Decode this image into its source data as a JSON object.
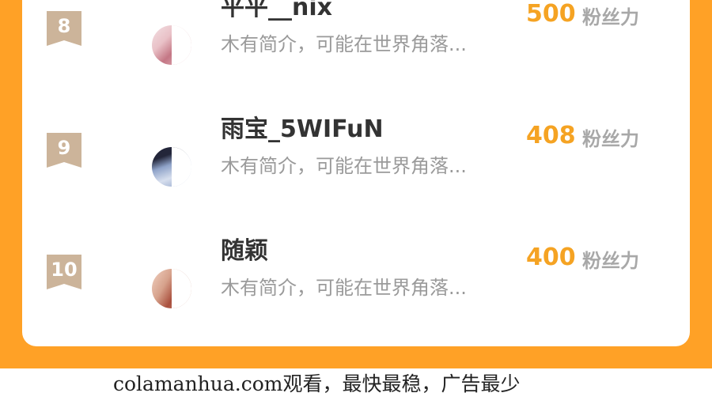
{
  "ranking": [
    {
      "rank": "8",
      "name": "平平__nix",
      "intro": "木有简介，可能在世界角落...",
      "score": "500",
      "unit": "粉丝力",
      "avatar_colors": [
        "#e9c1c7",
        "#c47785",
        "#f3e0e3"
      ]
    },
    {
      "rank": "9",
      "name": "雨宝_5WIFuN",
      "intro": "木有简介，可能在世界角落...",
      "score": "408",
      "unit": "粉丝力",
      "avatar_colors": [
        "#23263a",
        "#8fa3c9",
        "#d7dfee"
      ]
    },
    {
      "rank": "10",
      "name": "随颖",
      "intro": "木有简介，可能在世界角落...",
      "score": "400",
      "unit": "粉丝力",
      "avatar_colors": [
        "#a94f3d",
        "#d6a18b",
        "#f1d2c2"
      ]
    }
  ],
  "footer": {
    "text": "colamanhua.com观看，最快最稳，广告最少"
  },
  "colors": {
    "background_orange": "#ffa126",
    "score_orange": "#f5a323",
    "rank_badge": "#ccb49a"
  }
}
